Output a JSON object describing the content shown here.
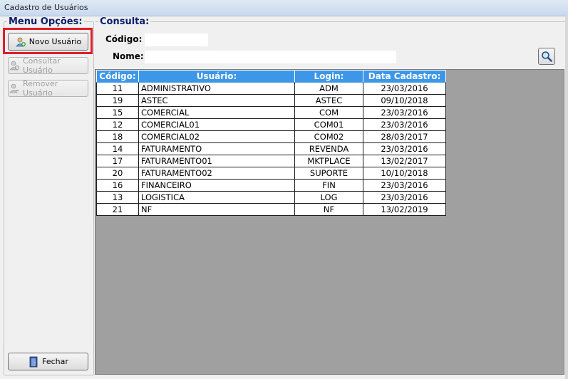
{
  "window": {
    "title": "Cadastro de Usuários"
  },
  "menu": {
    "legend": "Menu Opções:",
    "novo_label": "Novo Usuário",
    "consultar_label": "Consultar Usuário",
    "remover_label": "Remover Usuário",
    "fechar_label": "Fechar"
  },
  "consulta": {
    "legend": "Consulta:",
    "codigo_label": "Código:",
    "codigo_value": "",
    "nome_label": "Nome:",
    "nome_value": "",
    "search_icon": "magnifier-icon"
  },
  "grid": {
    "headers": [
      "Código:",
      "Usuário:",
      "Login:",
      "Data Cadastro:"
    ],
    "rows": [
      [
        "11",
        "ADMINISTRATIVO",
        "ADM",
        "23/03/2016"
      ],
      [
        "19",
        "ASTEC",
        "ASTEC",
        "09/10/2018"
      ],
      [
        "15",
        "COMERCIAL",
        "COM",
        "23/03/2016"
      ],
      [
        "12",
        "COMERCIAL01",
        "COM01",
        "23/03/2016"
      ],
      [
        "18",
        "COMERCIAL02",
        "COM02",
        "28/03/2017"
      ],
      [
        "14",
        "FATURAMENTO",
        "REVENDA",
        "23/03/2016"
      ],
      [
        "17",
        "FATURAMENTO01",
        "MKTPLACE",
        "13/02/2017"
      ],
      [
        "20",
        "FATURAMENTO02",
        "SUPORTE",
        "10/10/2018"
      ],
      [
        "16",
        "FINANCEIRO",
        "FIN",
        "23/03/2016"
      ],
      [
        "13",
        "LOGISTICA",
        "LOG",
        "23/03/2016"
      ],
      [
        "21",
        "NF",
        "NF",
        "13/02/2019"
      ]
    ]
  },
  "colors": {
    "header_bg": "#3d97e6",
    "highlight": "#e01e2a",
    "grid_bg": "#a0a0a0"
  }
}
